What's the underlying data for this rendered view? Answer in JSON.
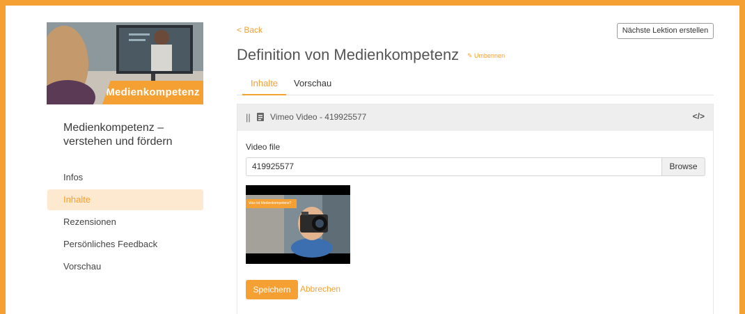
{
  "sidebar": {
    "thumbnail_label": "Medienkompetenz",
    "course_title": "Medienkompetenz – verstehen und fördern",
    "items": [
      {
        "label": "Infos"
      },
      {
        "label": "Inhalte",
        "active": true
      },
      {
        "label": "Rezensionen"
      },
      {
        "label": "Persönliches Feedback"
      },
      {
        "label": "Vorschau"
      }
    ]
  },
  "header": {
    "back_label": "< Back",
    "next_lesson_label": "Nächste Lektion erstellen",
    "title": "Definition von Medienkompetenz",
    "rename_label": "✎ Umbennen"
  },
  "tabs": [
    {
      "label": "Inhalte",
      "active": true
    },
    {
      "label": "Vorschau"
    }
  ],
  "block": {
    "drag_handle": "||",
    "title": "Vimeo Video - 419925577",
    "code_icon": "</>",
    "field_label": "Video file",
    "file_value": "419925577",
    "browse_label": "Browse",
    "thumbnail_caption": "Was ist Medienkompetenz?"
  },
  "actions": {
    "save_label": "Speichern",
    "cancel_label": "Abbrechen"
  },
  "colors": {
    "accent": "#f5a033",
    "active_bg": "#fde9cf"
  }
}
